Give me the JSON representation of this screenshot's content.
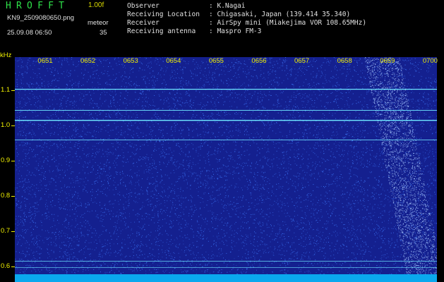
{
  "header": {
    "app_title": "HROFFT",
    "version": "1.00f",
    "filename": "KN9_2509080650.png",
    "mode": "meteor",
    "timestamp": "25.09.08 06:50",
    "count": "35",
    "info": [
      {
        "label": "Observer",
        "value": ": K.Nagai"
      },
      {
        "label": "Receiving Location",
        "value": ": Chigasaki, Japan (139.414 35.340)"
      },
      {
        "label": "Receiver",
        "value": ": AirSpy mini (Miakejima VOR 108.65MHz)"
      },
      {
        "label": "Receiving antenna",
        "value": ": Maspro FM-3"
      }
    ]
  },
  "spectrogram": {
    "y_unit": "kHz",
    "y_ticks": [
      "1.1",
      "1.0",
      "0.9",
      "0.8",
      "0.7",
      "0.6"
    ],
    "x_ticks": [
      "0651",
      "0652",
      "0653",
      "0654",
      "0655",
      "0656",
      "0657",
      "0658",
      "0659",
      "0700"
    ],
    "colors": {
      "background": "#14208f",
      "noise": "#3f7bff",
      "carrier": "#6fe8ff",
      "meteor": "#a7c8ff",
      "label": "#f0f000"
    }
  }
}
